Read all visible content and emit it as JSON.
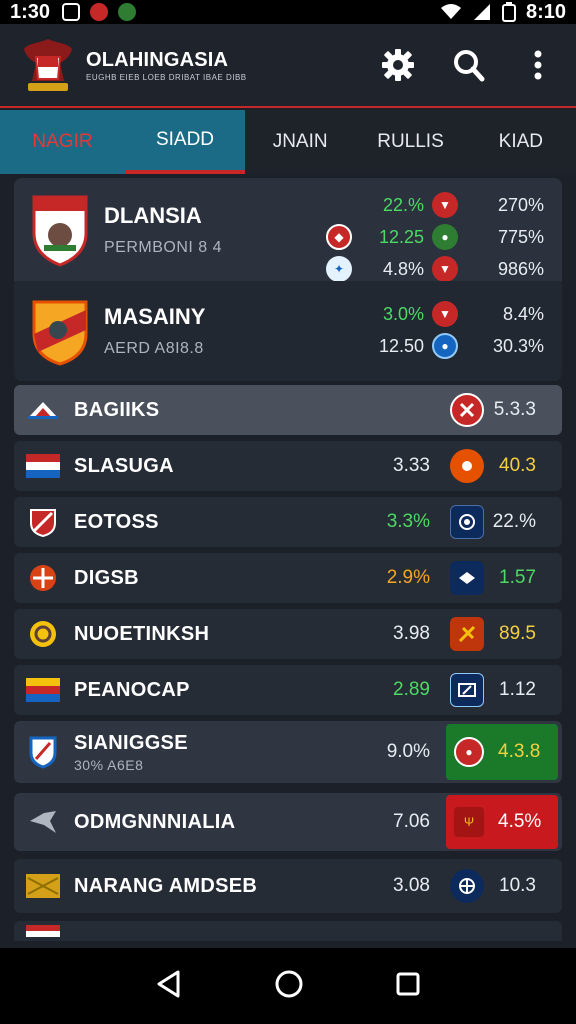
{
  "status_bar": {
    "time": "1:30",
    "clock": "8:10"
  },
  "app": {
    "title": "OLAHINGASIA",
    "tagline": "EUGHB EIEB LOEB DRIBAT IBAE DIBB"
  },
  "tabs": [
    {
      "label": "NAGIR"
    },
    {
      "label": "SIADD"
    },
    {
      "label": "JNAIN"
    },
    {
      "label": "RULLIS"
    },
    {
      "label": "KIAD"
    }
  ],
  "featured": [
    {
      "title": "DLANSIA",
      "subtitle": "PERMBONI 8 4",
      "stats": [
        {
          "value": "22.%",
          "value_color": "#4cd964",
          "pct": "270%"
        },
        {
          "value": "12.25",
          "value_color": "#4cd964",
          "pct": "775%"
        },
        {
          "value": "4.8%",
          "value_color": "#e8ecf2",
          "pct": "986%"
        }
      ]
    },
    {
      "title": "MASAINY",
      "subtitle": "AERD A8I8.8",
      "stats": [
        {
          "value": "3.0%",
          "value_color": "#4cd964",
          "pct": "8.4%"
        },
        {
          "value": "12.50",
          "value_color": "#e8ecf2",
          "pct": "30.3%"
        }
      ]
    }
  ],
  "rows": [
    {
      "label": "BAGIIKS",
      "subtitle": "",
      "value": "",
      "value_color": "#e8ecf2",
      "odds": "5.3.3",
      "odds_color": "#e8ecf2"
    },
    {
      "label": "SLASUGA",
      "subtitle": "",
      "value": "3.33",
      "value_color": "#e8ecf2",
      "odds": "40.3",
      "odds_color": "#f4d03f"
    },
    {
      "label": "EOTOSS",
      "subtitle": "",
      "value": "3.3%",
      "value_color": "#4cd964",
      "odds": "22.%",
      "odds_color": "#e8ecf2"
    },
    {
      "label": "DIGSB",
      "subtitle": "",
      "value": "2.9%",
      "value_color": "#f5a623",
      "odds": "1.57",
      "odds_color": "#4cd964"
    },
    {
      "label": "NUOETINKSH",
      "subtitle": "",
      "value": "3.98",
      "value_color": "#e8ecf2",
      "odds": "89.5",
      "odds_color": "#f4d03f"
    },
    {
      "label": "PEANOCAP",
      "subtitle": "",
      "value": "2.89",
      "value_color": "#4cd964",
      "odds": "1.12",
      "odds_color": "#e8ecf2"
    },
    {
      "label": "SIANIGGSE",
      "subtitle": "30% A6E8",
      "value": "9.0%",
      "value_color": "#e8ecf2",
      "odds": "4.3.8",
      "odds_color": "#f4d03f"
    },
    {
      "label": "ODMGNNNIALIA",
      "subtitle": "",
      "value": "7.06",
      "value_color": "#e8ecf2",
      "odds": "4.5%",
      "odds_color": "#ffffff"
    },
    {
      "label": "NARANG AMDSEB",
      "subtitle": "",
      "value": "3.08",
      "value_color": "#e8ecf2",
      "odds": "10.3",
      "odds_color": "#e8ecf2"
    }
  ]
}
